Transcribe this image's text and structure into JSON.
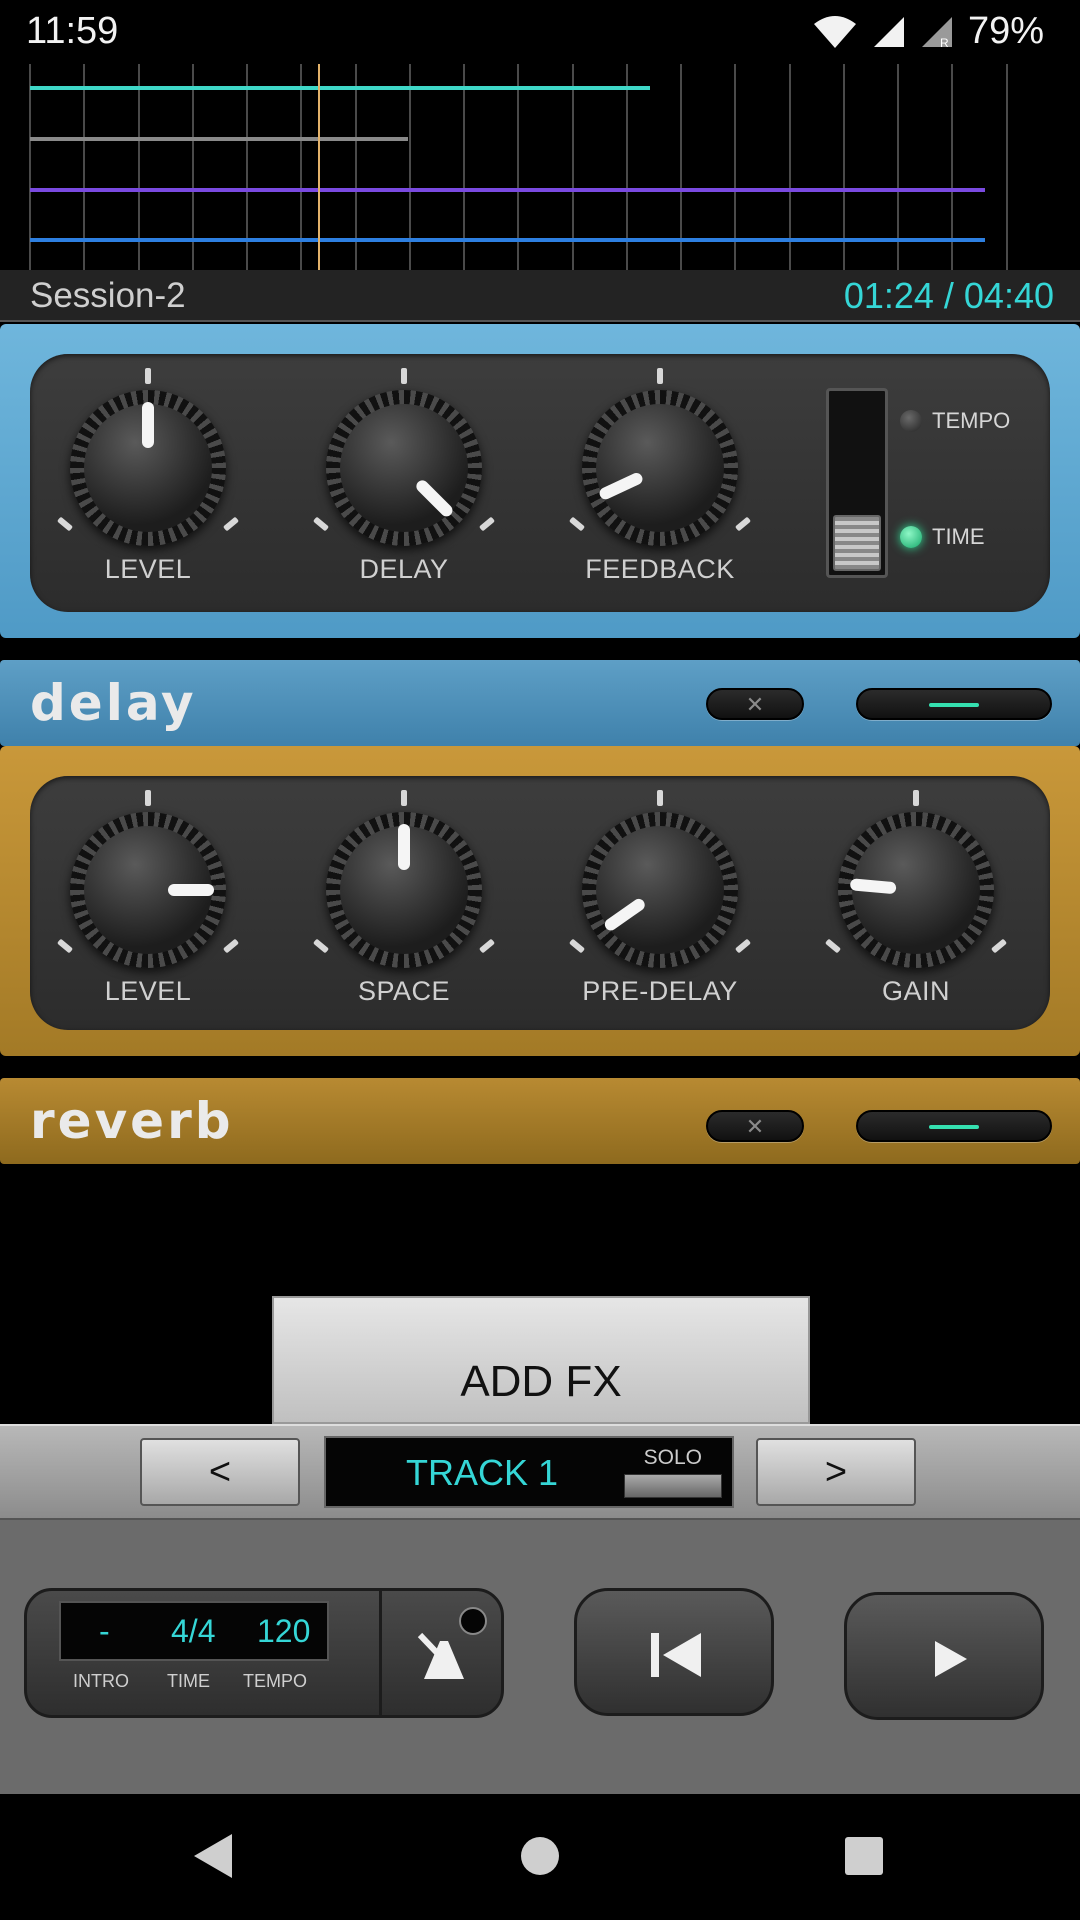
{
  "status_bar": {
    "time": "11:59",
    "battery": "79%"
  },
  "session": {
    "name": "Session-2",
    "position": "01:24 / 04:40"
  },
  "delay_fx": {
    "name": "delay",
    "knobs": [
      {
        "label": "LEVEL"
      },
      {
        "label": "DELAY"
      },
      {
        "label": "FEEDBACK"
      }
    ],
    "switch_options": [
      "TEMPO",
      "TIME"
    ],
    "selected_option": "TIME"
  },
  "reverb_fx": {
    "name": "reverb",
    "knobs": [
      {
        "label": "LEVEL"
      },
      {
        "label": "SPACE"
      },
      {
        "label": "PRE-DELAY"
      },
      {
        "label": "GAIN"
      }
    ]
  },
  "add_fx_label": "ADD FX",
  "track_nav": {
    "prev_label": "<",
    "next_label": ">",
    "track_name": "TRACK 1",
    "solo_label": "SOLO"
  },
  "tempo_panel": {
    "intro_value": "-",
    "time_value": "4/4",
    "tempo_value": "120",
    "intro_label": "INTRO",
    "time_label": "TIME",
    "tempo_label": "TEMPO"
  },
  "colors": {
    "accent": "#35d6d6",
    "delay_panel": "#5fa5cf",
    "reverb_panel": "#b8893a"
  }
}
